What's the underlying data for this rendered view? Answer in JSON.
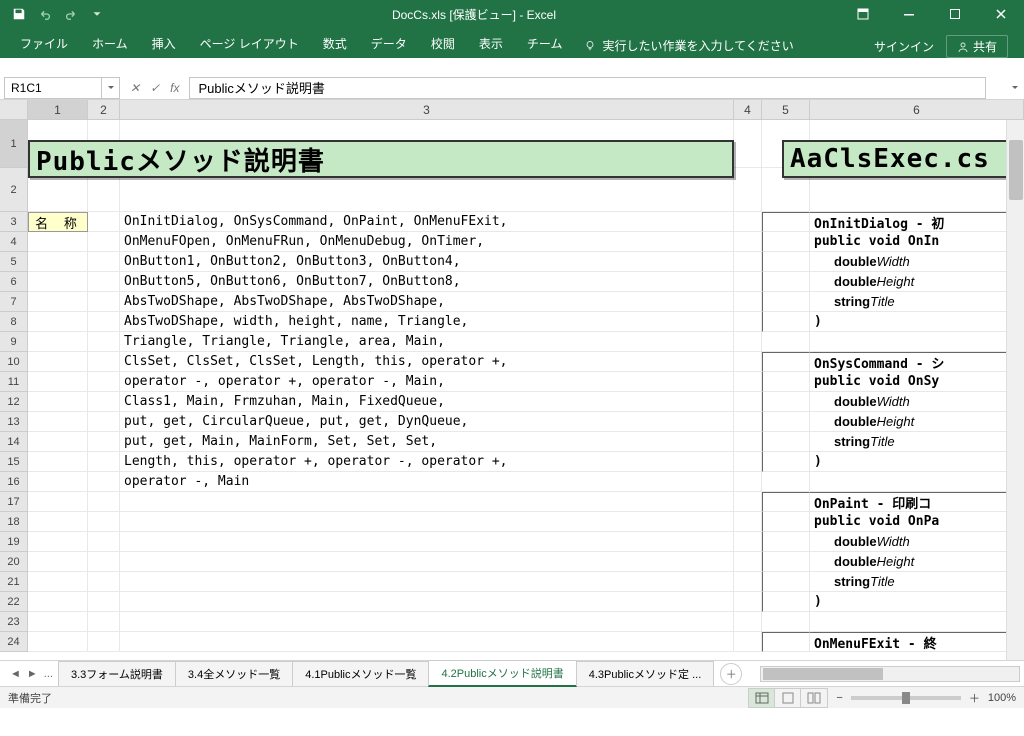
{
  "titlebar": {
    "filename": "DocCs.xls",
    "mode": "[保護ビュー]",
    "app": "- Excel"
  },
  "ribbon": {
    "tabs": [
      "ファイル",
      "ホーム",
      "挿入",
      "ページ レイアウト",
      "数式",
      "データ",
      "校閲",
      "表示",
      "チーム"
    ],
    "tellme": "実行したい作業を入力してください",
    "signin": "サインイン",
    "share": "共有"
  },
  "formula": {
    "namebox": "R1C1",
    "fx": "fx",
    "value": "Publicメソッド説明書"
  },
  "columns": {
    "labels": [
      "1",
      "2",
      "3",
      "4",
      "5",
      "6"
    ],
    "widths": [
      60,
      32,
      614,
      28,
      48,
      48
    ]
  },
  "rows": {
    "count": 24,
    "row1_height": 48
  },
  "titles": {
    "main": "Publicメソッド説明書",
    "file": "AaClsExec.cs"
  },
  "label_cell": "名 称",
  "method_lines": [
    "OnInitDialog, OnSysCommand, OnPaint, OnMenuFExit,",
    "OnMenuFOpen, OnMenuFRun, OnMenuDebug, OnTimer,",
    "OnButton1, OnButton2, OnButton3, OnButton4,",
    "OnButton5, OnButton6, OnButton7, OnButton8,",
    "AbsTwoDShape, AbsTwoDShape, AbsTwoDShape,",
    "AbsTwoDShape, width, height, name, Triangle,",
    "Triangle, Triangle, Triangle, area, Main,",
    "ClsSet, ClsSet, ClsSet, Length, this, operator +,",
    "operator -, operator +, operator -, Main,",
    "Class1, Main, Frmzuhan, Main, FixedQueue,",
    "put, get, CircularQueue, put, get, DynQueue,",
    "put, get, Main, MainForm, Set, Set, Set,",
    "Length, this, operator +, operator -, operator +,",
    "operator -, Main"
  ],
  "right_blocks": [
    {
      "header": "OnInitDialog - 初",
      "sig": "public void OnIn",
      "params": [
        [
          "double",
          "Width"
        ],
        [
          "double",
          "Height"
        ],
        [
          "string",
          "Title"
        ]
      ],
      "close": ")"
    },
    {
      "header": "OnSysCommand - シ",
      "sig": "public void OnSy",
      "params": [
        [
          "double",
          "Width"
        ],
        [
          "double",
          "Height"
        ],
        [
          "string",
          "Title"
        ]
      ],
      "close": ")"
    },
    {
      "header": "OnPaint - 印刷コ",
      "sig": "public void OnPa",
      "params": [
        [
          "double",
          "Width"
        ],
        [
          "double",
          "Height"
        ],
        [
          "string",
          "Title"
        ]
      ],
      "close": ")"
    },
    {
      "header": "OnMenuFExit - 終"
    }
  ],
  "sheet_tabs": {
    "ellipsis": "...",
    "tabs": [
      "3.3フォーム説明書",
      "3.4全メソッド一覧",
      "4.1Publicメソッド一覧",
      "4.2Publicメソッド説明書",
      "4.3Publicメソッド定"
    ],
    "active_index": 3,
    "truncated_suffix": "..."
  },
  "statusbar": {
    "ready": "準備完了",
    "zoom": "100%"
  },
  "colors": {
    "excel_green": "#217346",
    "title_bg": "#c5e8c5",
    "label_bg": "#ffffcc"
  }
}
